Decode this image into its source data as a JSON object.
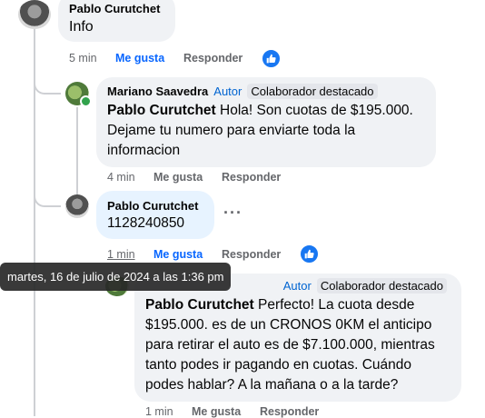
{
  "comments": [
    {
      "author": "Pablo Curutchet",
      "text": "Info",
      "time": "5 min",
      "like_label": "Me gusta",
      "reply_label": "Responder",
      "reaction_icon": "like-icon"
    },
    {
      "author": "Mariano Saavedra",
      "badge_author": "Autor",
      "badge_fan": "Colaborador destacado",
      "mention": "Pablo Curutchet",
      "text_line1": " Hola! Son cuotas de $195.000.",
      "text_line2": "Dejame tu numero para enviarte toda la",
      "text_line3": "informacion",
      "time": "4 min",
      "like_label": "Me gusta",
      "reply_label": "Responder"
    },
    {
      "author": "Pablo Curutchet",
      "text": "1128240850",
      "time": "1 min",
      "like_label": "Me gusta",
      "reply_label": "Responder",
      "reaction_icon": "like-icon",
      "more_label": "···"
    },
    {
      "author": "Mariano Saavedra",
      "badge_author": "Autor",
      "badge_fan": "Colaborador destacado",
      "mention": "Pablo Curutchet",
      "text_line1": " Perfecto! La cuota desde",
      "text_line2": "$195.000. es de un CRONOS 0KM el anticipo",
      "text_line3": "para retirar el auto es de $7.100.000, mientras",
      "text_line4": "tanto podes ir pagando en cuotas. Cuándo",
      "text_line5": "podes hablar? A la mañana o a la tarde?",
      "time": "1 min",
      "like_label": "Me gusta",
      "reply_label": "Responder"
    }
  ],
  "tooltip": "martes, 16 de julio de 2024 a las 1:36 pm",
  "colors": {
    "bubble": "#f0f2f5",
    "bubble_active": "#e7f3ff",
    "liked": "#0866ff",
    "muted": "#65676b",
    "author_badge": "#0064d1"
  }
}
